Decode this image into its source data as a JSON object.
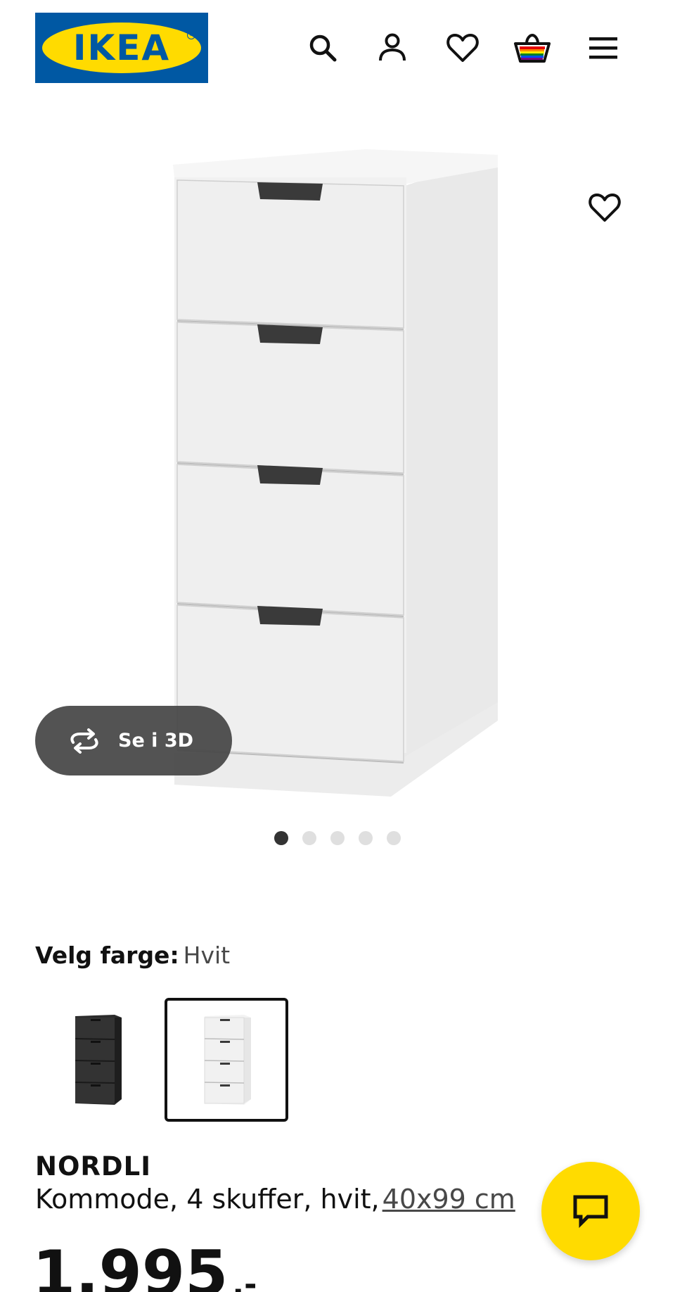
{
  "header": {
    "logo_text": "IKEA",
    "logo_mark": "®",
    "icons": [
      "search-icon",
      "account-icon",
      "favorites-icon",
      "cart-icon",
      "menu-icon"
    ]
  },
  "gallery": {
    "view_3d_label": "Se i 3D",
    "slide_count": 5,
    "active_slide": 1
  },
  "color": {
    "label": "Velg farge:",
    "selected_value": "Hvit",
    "options": [
      "black",
      "white"
    ],
    "selected_index": 1
  },
  "product": {
    "name": "NORDLI",
    "description": "Kommode, 4 skuffer, hvit,",
    "size": "40x99 cm",
    "price": "1.995",
    "price_suffix": ",-"
  },
  "colors": {
    "brand_blue": "#0058a3",
    "brand_yellow": "#ffdb00",
    "text": "#111111"
  }
}
